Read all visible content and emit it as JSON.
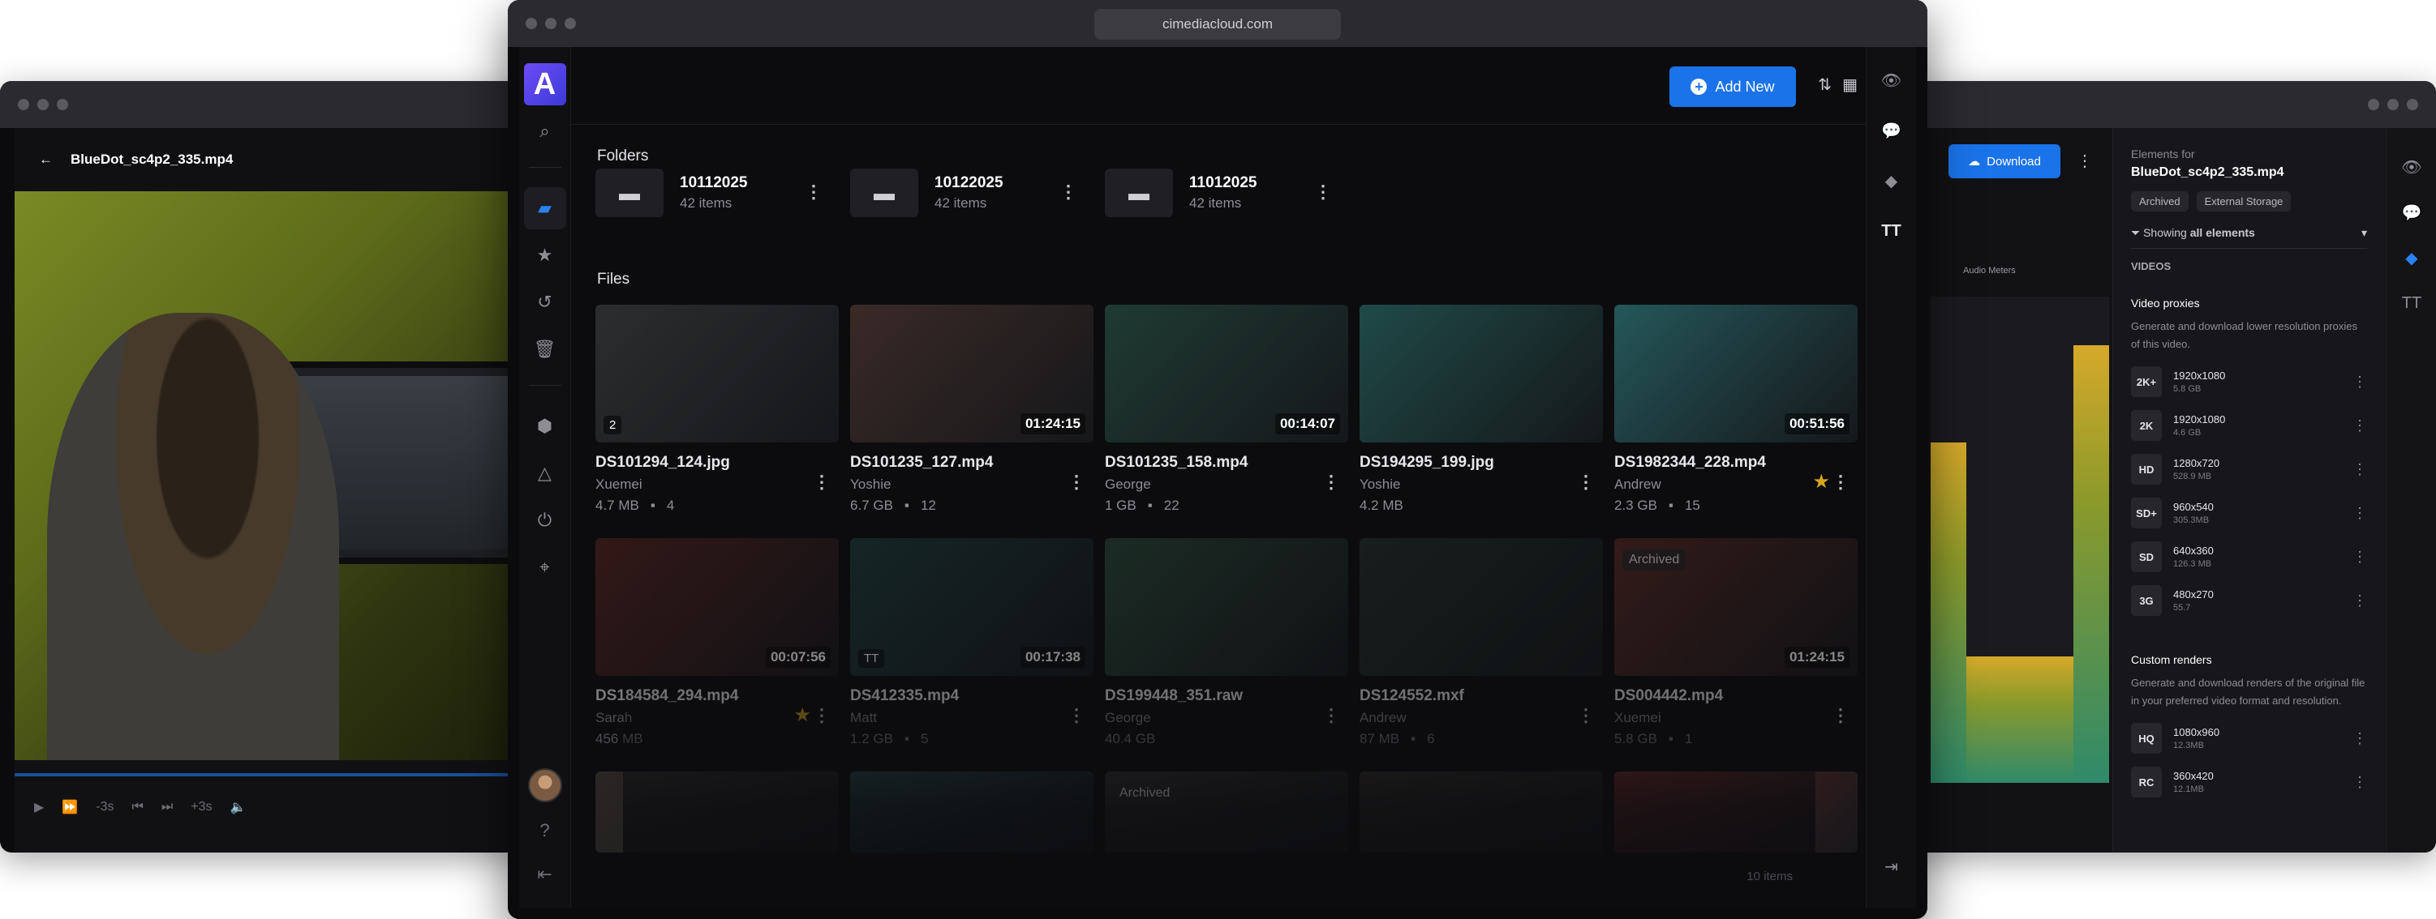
{
  "main": {
    "url": "cimediacloud.com",
    "add_new_label": "Add New",
    "folders_heading": "Folders",
    "files_heading": "Files",
    "folders": [
      {
        "name": "10112025",
        "count": "42 items"
      },
      {
        "name": "10122025",
        "count": "42 items"
      },
      {
        "name": "11012025",
        "count": "42 items"
      }
    ],
    "files": [
      {
        "name": "DS101294_124.jpg",
        "user": "Xuemei",
        "size": "4.7 MB",
        "comments": "4",
        "duration": "",
        "badge": "2",
        "starred": false,
        "thumb": "#2b2d2f"
      },
      {
        "name": "DS101235_127.mp4",
        "user": "Yoshie",
        "size": "6.7 GB",
        "comments": "12",
        "duration": "01:24:15",
        "badge": "",
        "starred": false,
        "thumb": "#3a2a27"
      },
      {
        "name": "DS101235_158.mp4",
        "user": "George",
        "size": "1 GB",
        "comments": "22",
        "duration": "00:14:07",
        "badge": "",
        "starred": false,
        "thumb": "#1f3a33"
      },
      {
        "name": "DS194295_199.jpg",
        "user": "Yoshie",
        "size": "4.2 MB",
        "comments": "",
        "duration": "",
        "badge": "",
        "starred": false,
        "thumb": "#1f4a48"
      },
      {
        "name": "DS1982344_228.mp4",
        "user": "Andrew",
        "size": "2.3 GB",
        "comments": "15",
        "duration": "00:51:56",
        "badge": "",
        "starred": true,
        "thumb": "#24575a"
      },
      {
        "name": "DS184584_294.mp4",
        "user": "Sarah",
        "size": "456 MB",
        "comments": "",
        "duration": "00:07:56",
        "badge": "",
        "starred": true,
        "thumb": "#5a2420"
      },
      {
        "name": "DS412335.mp4",
        "user": "Matt",
        "size": "1.2 GB",
        "comments": "5",
        "duration": "00:17:38",
        "badge": "TT",
        "starred": false,
        "thumb": "#1f3e3c"
      },
      {
        "name": "DS199448_351.raw",
        "user": "George",
        "size": "40.4 GB",
        "comments": "",
        "duration": "",
        "badge": "",
        "starred": false,
        "thumb": "#2b4a3a"
      },
      {
        "name": "DS124552.mxf",
        "user": "Andrew",
        "size": "87 MB",
        "comments": "6",
        "duration": "",
        "badge": "",
        "starred": false,
        "thumb": "#22302a"
      },
      {
        "name": "DS004442.mp4",
        "user": "Xuemei",
        "size": "5.8 GB",
        "comments": "1",
        "duration": "01:24:15",
        "badge": "Archived",
        "starred": false,
        "thumb": "#5a2a24"
      }
    ],
    "row3": [
      {
        "badge": "",
        "thumb": "#2a2624"
      },
      {
        "badge": "",
        "thumb": "#1f3b3e"
      },
      {
        "badge": "Archived",
        "thumb": "#2a2a2a"
      },
      {
        "badge": "",
        "thumb": "#2a2622"
      },
      {
        "badge": "",
        "thumb": "#5a2222"
      }
    ],
    "footer_count": "10 items"
  },
  "left_window": {
    "file_title": "BlueDot_sc4p2_335.mp4",
    "controls": [
      "-3s",
      "+3s"
    ]
  },
  "right_window": {
    "download_label": "Download",
    "audio_meters_label": "Audio Meters",
    "elements_for": "Elements for",
    "file_name": "BlueDot_sc4p2_335.mp4",
    "tags": [
      "Archived",
      "External Storage"
    ],
    "showing_prefix": "Showing",
    "showing_value": "all elements",
    "videos_heading": "VIDEOS",
    "proxies_title": "Video proxies",
    "proxies_desc": "Generate and download lower resolution proxies of this video.",
    "proxies": [
      {
        "q": "2K+",
        "res": "1920x1080",
        "size": "5.8 GB"
      },
      {
        "q": "2K",
        "res": "1920x1080",
        "size": "4.6 GB"
      },
      {
        "q": "HD",
        "res": "1280x720",
        "size": "528.9 MB"
      },
      {
        "q": "SD+",
        "res": "960x540",
        "size": "305.3MB"
      },
      {
        "q": "SD",
        "res": "640x360",
        "size": "126.3 MB"
      },
      {
        "q": "3G",
        "res": "480x270",
        "size": "55.7"
      }
    ],
    "custom_title": "Custom renders",
    "custom_desc": "Generate and download renders of the original file in your preferred video format and resolution.",
    "custom": [
      {
        "q": "HQ",
        "res": "1080x960",
        "size": "12.3MB"
      },
      {
        "q": "RC",
        "res": "360x420",
        "size": "12.1MB"
      }
    ],
    "meter_levels": [
      0.7,
      0.7,
      0.26,
      0.26,
      0.26,
      0.26,
      0.26,
      0.26,
      0.9,
      0.9
    ]
  },
  "colors": {
    "accent": "#1a73e8",
    "star": "#d9a520",
    "background": "#0c0c0f"
  }
}
